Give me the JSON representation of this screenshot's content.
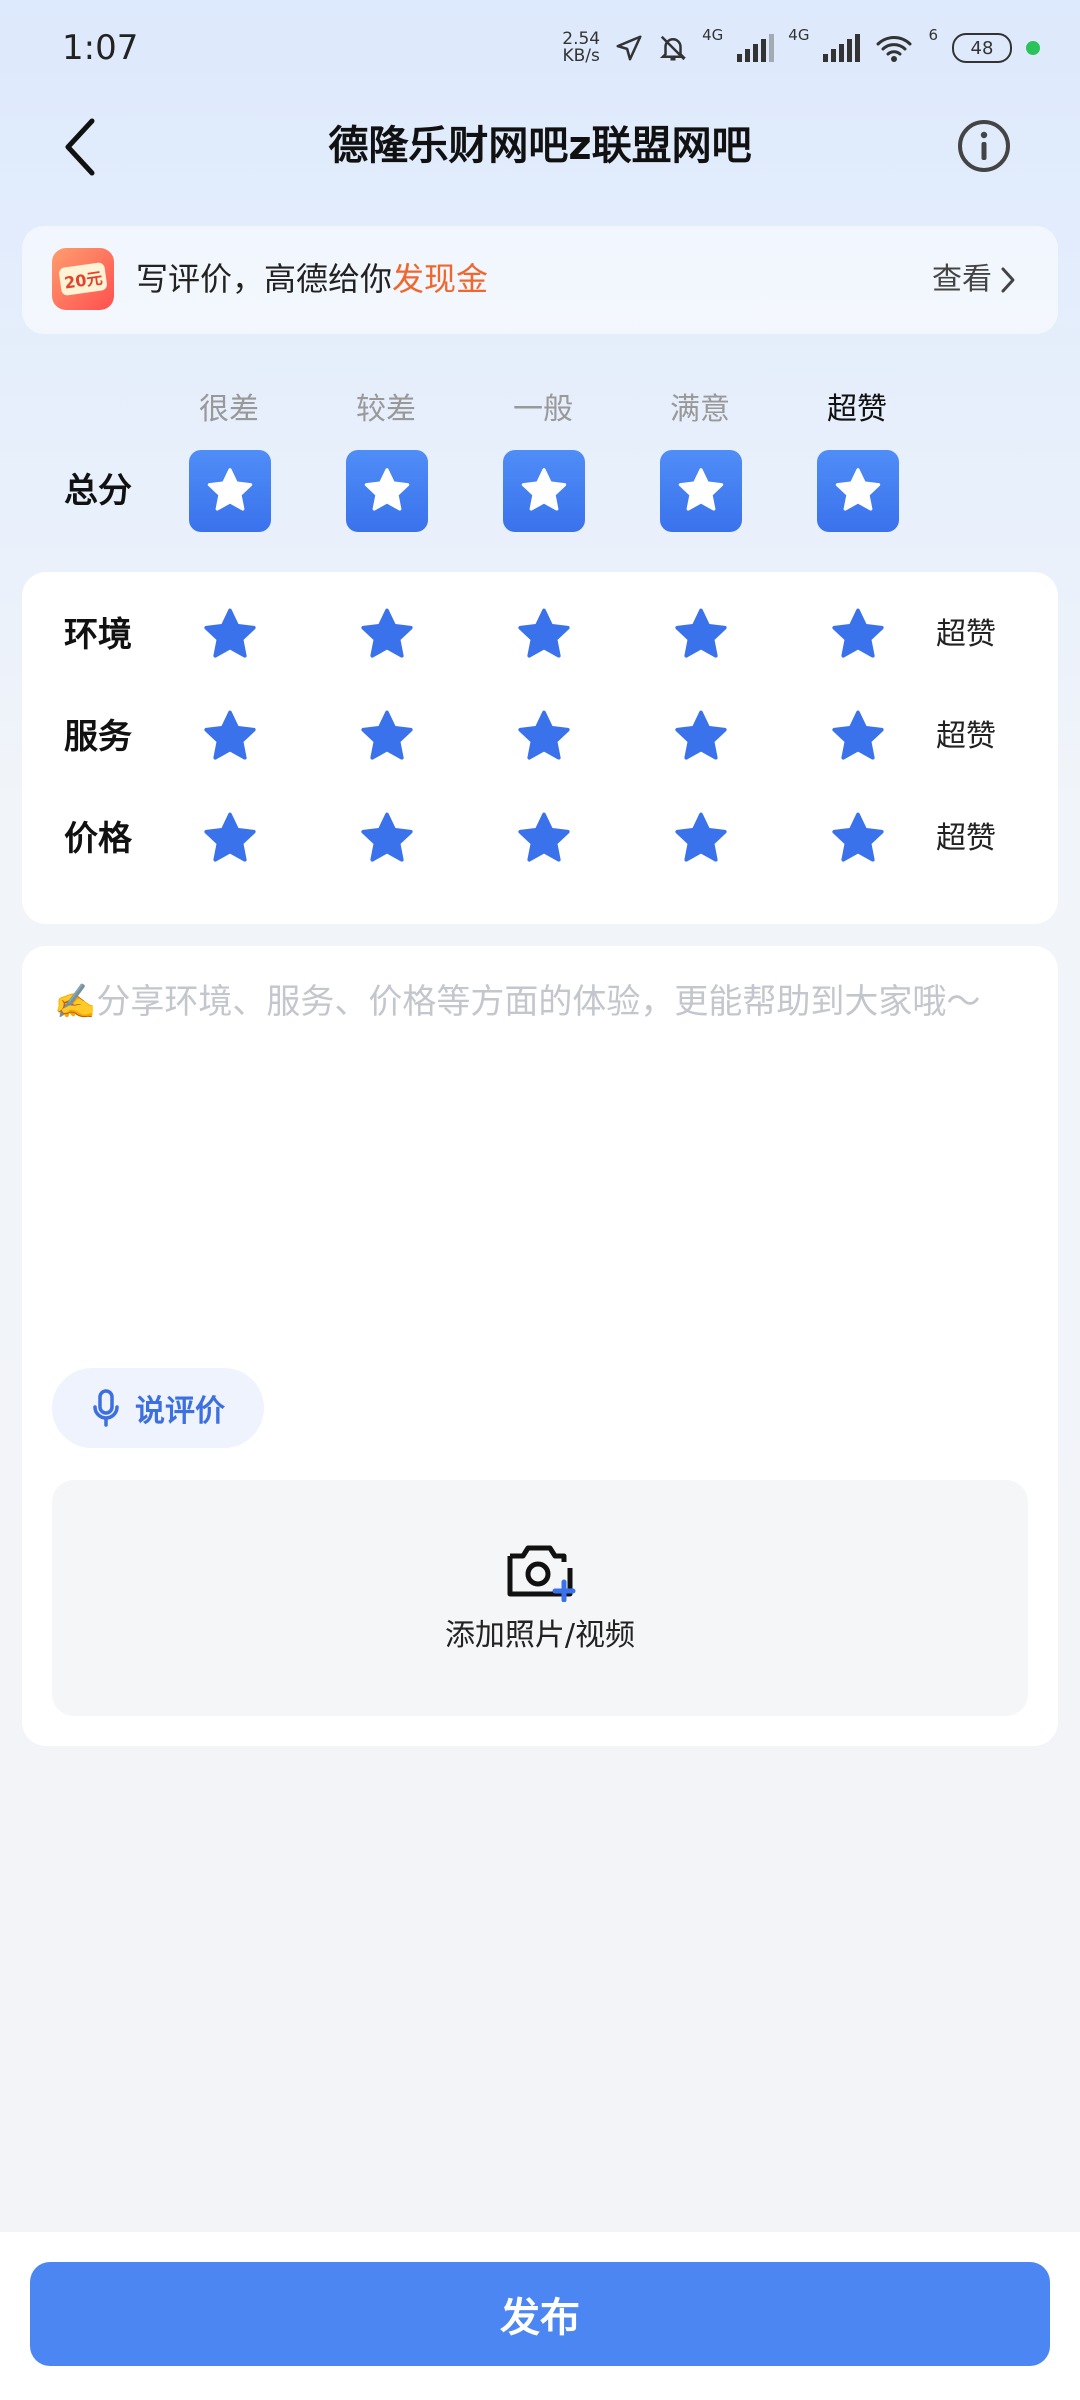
{
  "status_bar": {
    "time": "1:07",
    "speed": "2.54",
    "speed_unit": "KB/s",
    "network_1": "4G",
    "network_2": "4G",
    "wifi_level": "6",
    "battery": "48"
  },
  "header": {
    "title": "德隆乐财网吧z联盟网吧"
  },
  "banner": {
    "icon_text": "20元",
    "text_prefix": "写评价，高德给你",
    "text_highlight": "发现金",
    "view_label": "查看"
  },
  "rating": {
    "levels": [
      "很差",
      "较差",
      "一般",
      "满意",
      "超赞"
    ],
    "active_level_index": 4,
    "overall_label": "总分",
    "overall_score": 5,
    "max_score": 5,
    "sub_ratings": [
      {
        "label": "环境",
        "value": "超赞",
        "score": 5
      },
      {
        "label": "服务",
        "value": "超赞",
        "score": 5
      },
      {
        "label": "价格",
        "value": "超赞",
        "score": 5
      }
    ]
  },
  "review": {
    "placeholder": "✍️分享环境、服务、价格等方面的体验，更能帮助到大家哦～",
    "value": "",
    "voice_label": "说评价",
    "add_media_label": "添加照片/视频"
  },
  "footer": {
    "publish_label": "发布"
  },
  "colors": {
    "accent": "#4b86f2",
    "star": "#3a72ec",
    "highlight": "#f0672e"
  }
}
